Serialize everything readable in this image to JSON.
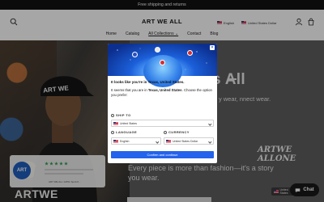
{
  "announcement": {
    "text": "Free shipping and returns"
  },
  "header": {
    "logo": "ART WE ALL",
    "language": "English",
    "currency": "United States Dollar"
  },
  "nav": {
    "items": [
      {
        "label": "Home"
      },
      {
        "label": "Catalog"
      },
      {
        "label": "All Collections ⌄"
      },
      {
        "label": "Contact"
      },
      {
        "label": "Blog"
      }
    ]
  },
  "hero": {
    "title": "Us All",
    "body": "y wear, nnect wear.",
    "tagline": "Every piece is more than fashion—it's a story you wear.",
    "under_text": "ARTWE",
    "mark_line1": "ARTWE",
    "mark_line2": "ALLONE"
  },
  "reviews_widget": {
    "logo": "ART",
    "rating_stars": 5,
    "footer": "ART WE ALL   12451 Spott-fl..."
  },
  "language_pill": {
    "label": "United States"
  },
  "chat": {
    "label": "Chat"
  },
  "modal": {
    "heading": "It looks like you're in Texas, United States.",
    "desc_prefix": "It seems that you are in ",
    "desc_location": "Texas, United States",
    "desc_suffix": ". Choose the option you prefer:",
    "ship_to_label": "SHIP TO",
    "ship_to_value": "United States",
    "language_label": "LANGUAGE",
    "language_value": "English",
    "currency_label": "CURRENCY",
    "currency_value": "United States Dollar",
    "confirm_label": "Confirm and continue",
    "close_label": "×"
  },
  "colors": {
    "primary_button": "#2463eb",
    "announcement_bg": "#111111",
    "review_star": "#2e9b4a"
  }
}
